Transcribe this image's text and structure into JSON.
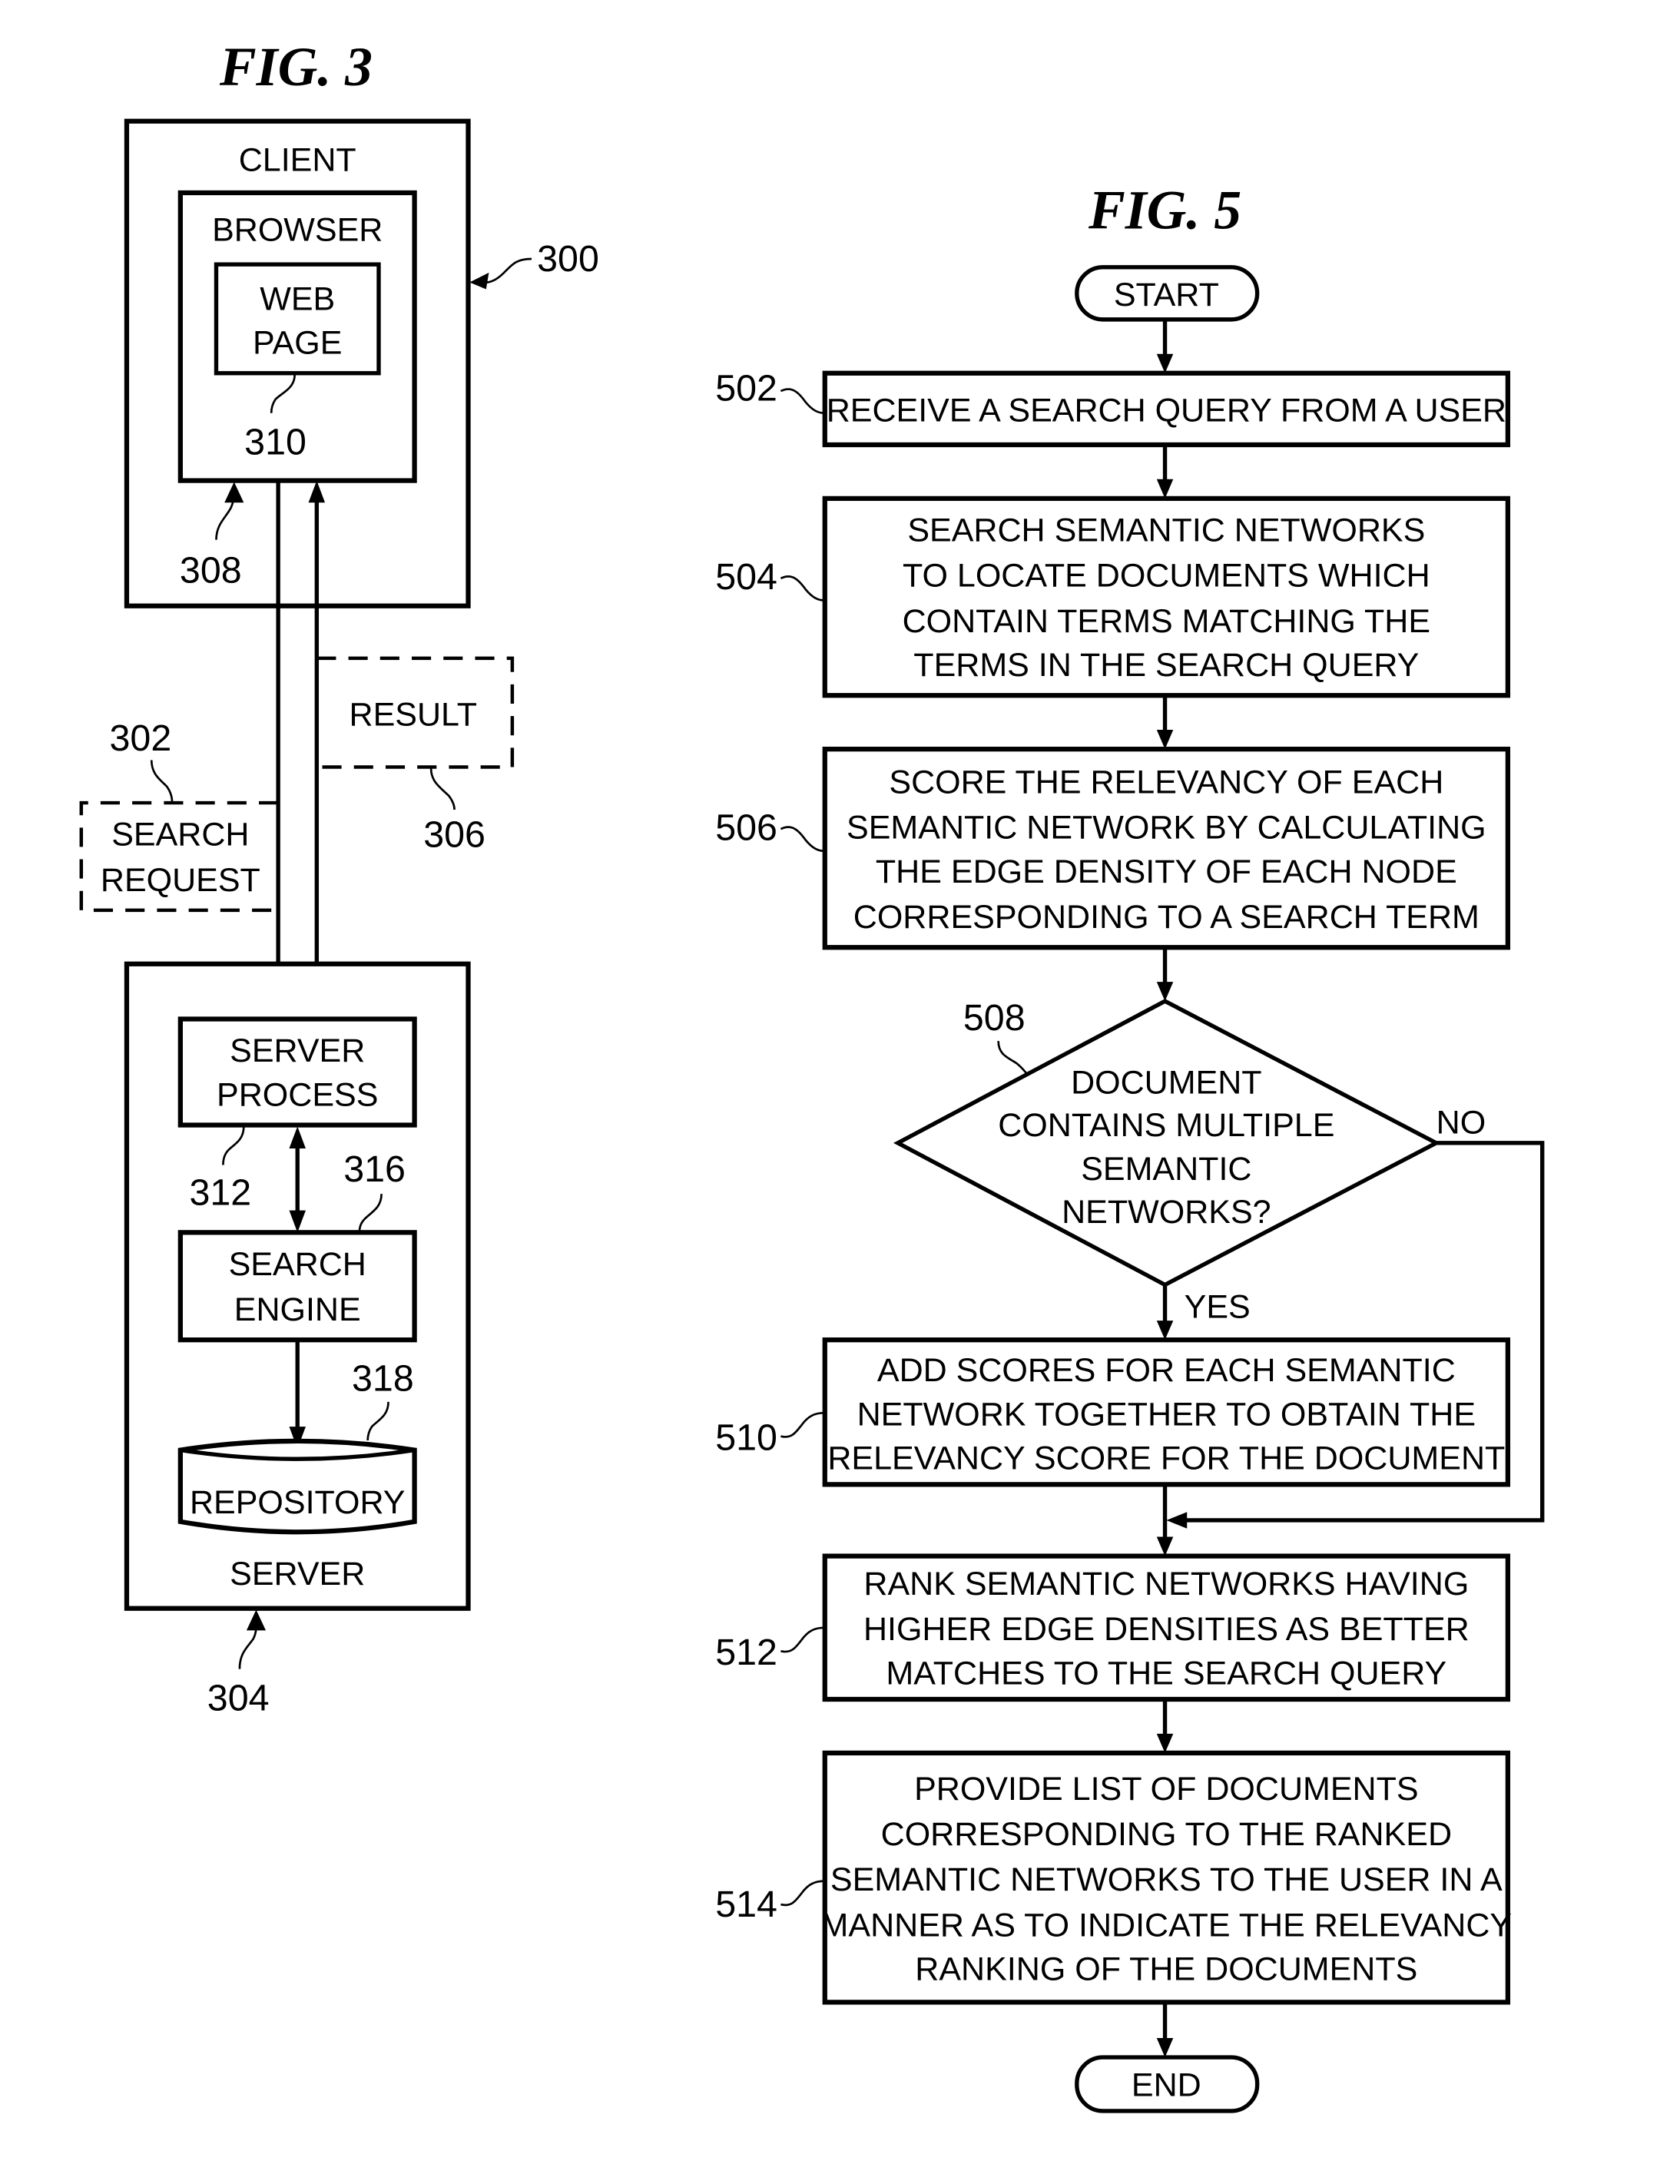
{
  "fig3": {
    "title": "FIG. 3",
    "client": {
      "label": "CLIENT",
      "ref": "300"
    },
    "browser": {
      "label": "BROWSER",
      "ref": "308"
    },
    "web_page": {
      "lines": [
        "WEB",
        "PAGE"
      ],
      "ref": "310"
    },
    "search_request": {
      "lines": [
        "SEARCH",
        "REQUEST"
      ],
      "ref": "302"
    },
    "result": {
      "label": "RESULT",
      "ref": "306"
    },
    "server": {
      "label": "SERVER",
      "ref": "304"
    },
    "server_process": {
      "lines": [
        "SERVER",
        "PROCESS"
      ],
      "ref": "312"
    },
    "search_engine": {
      "lines": [
        "SEARCH",
        "ENGINE"
      ],
      "ref": "316"
    },
    "repository": {
      "label": "REPOSITORY",
      "ref": "318"
    }
  },
  "fig5": {
    "title": "FIG. 5",
    "start": "START",
    "end": "END",
    "steps": [
      {
        "ref": "502",
        "lines": [
          "RECEIVE A SEARCH QUERY FROM A USER"
        ]
      },
      {
        "ref": "504",
        "lines": [
          "SEARCH SEMANTIC NETWORKS",
          "TO LOCATE DOCUMENTS WHICH",
          "CONTAIN TERMS MATCHING THE",
          "TERMS IN THE SEARCH QUERY"
        ]
      },
      {
        "ref": "506",
        "lines": [
          "SCORE THE RELEVANCY OF EACH",
          "SEMANTIC NETWORK BY CALCULATING",
          "THE EDGE DENSITY OF EACH NODE",
          "CORRESPONDING TO A SEARCH TERM"
        ]
      },
      {
        "ref": "510",
        "lines": [
          "ADD SCORES FOR EACH SEMANTIC",
          "NETWORK TOGETHER TO OBTAIN THE",
          "RELEVANCY SCORE FOR THE DOCUMENT"
        ]
      },
      {
        "ref": "512",
        "lines": [
          "RANK SEMANTIC NETWORKS HAVING",
          "HIGHER EDGE DENSITIES AS BETTER",
          "MATCHES TO THE SEARCH QUERY"
        ]
      },
      {
        "ref": "514",
        "lines": [
          "PROVIDE LIST OF DOCUMENTS",
          "CORRESPONDING TO THE RANKED",
          "SEMANTIC NETWORKS TO THE USER IN A",
          "MANNER AS TO INDICATE THE RELEVANCY",
          "RANKING OF THE DOCUMENTS"
        ]
      }
    ],
    "decision": {
      "ref": "508",
      "lines": [
        "DOCUMENT",
        "CONTAINS MULTIPLE",
        "SEMANTIC",
        "NETWORKS?"
      ],
      "yes_label": "YES",
      "no_label": "NO"
    }
  }
}
